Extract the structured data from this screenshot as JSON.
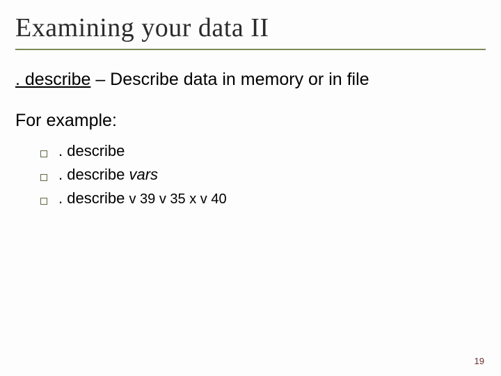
{
  "title": "Examining your data II",
  "command_name": ". describe",
  "command_desc": " – Describe data in memory or in file",
  "for_example": "For example:",
  "bullets": [
    {
      "text": ". describe",
      "italic": "",
      "small": ""
    },
    {
      "text": ". describe ",
      "italic": "vars",
      "small": ""
    },
    {
      "text": ". describe ",
      "italic": "",
      "small": "v 39 v 35 x v 40"
    }
  ],
  "page_number": "19"
}
